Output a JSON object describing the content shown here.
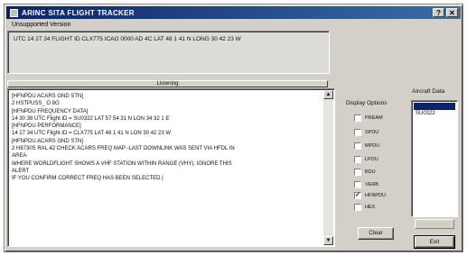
{
  "window": {
    "title": "ARINC SITA FLIGHT TRACKER",
    "subtitle": "Unsupported Version"
  },
  "top_panel": {
    "message": "UTC 14 27 34  FLIGHT ID CLX775 ICAO 0000 AD 4C LAT 48 1 41  N  LONG 30 42 23  W"
  },
  "listening": {
    "header": "Listening",
    "lines": [
      "[HFNPDU ACARS GND STN]",
      " 2 HSTPUSS_ O 8O",
      "[HFNPDU FREQUENCY DATA]",
      "14 30 38  UTC  Flight ID = SU0322  LAT 57 54 31  N  LON 34 32 1  E",
      "[HFNPDU PERFORMANCE]",
      "14 27 34  UTC  Flight ID = CLX775  LAT 48 1 41  N  LON 30 42 23  W",
      "[HFNPDU ACARS GND STN]",
      " 2 H8730S RAL 42 CHECK ACARS FREQ MAP  -LAST DOWNLINK WAS  SENT VIA HFDL IN",
      "AREA",
      "  WHERE WORLDFLIGHT  SHOWS A VHF STATION  WITHIN RANGE (VHY).  IGNORE THIS",
      "ALERT",
      "  IF  YOU CONFIRM CORRECT  FREQ HAS BEEN SELECTED   |"
    ]
  },
  "display_options": {
    "title": "Display Options",
    "options": [
      {
        "label": "PREAM",
        "checked": false
      },
      {
        "label": "SPDU",
        "checked": false
      },
      {
        "label": "MPDU",
        "checked": false
      },
      {
        "label": "LPDU",
        "checked": false
      },
      {
        "label": "BDU",
        "checked": false
      },
      {
        "label": "VERB",
        "checked": false
      },
      {
        "label": "HFNPDU",
        "checked": true
      },
      {
        "label": "HEX",
        "checked": false
      }
    ]
  },
  "aircraft_data": {
    "title": "Aircraft Data",
    "items": [
      "",
      "SU0322"
    ]
  },
  "buttons": {
    "clear": "Clear",
    "exit": "Exit"
  },
  "colors": {
    "titlebar": "#0a246a",
    "face": "#d4d0c8",
    "selection": "#0a246a"
  }
}
